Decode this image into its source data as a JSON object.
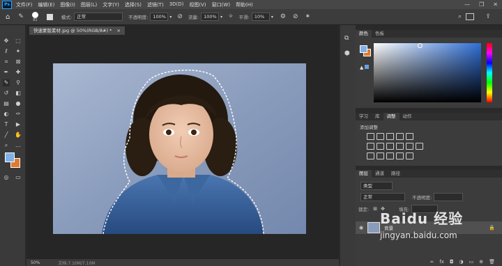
{
  "app": {
    "logo": "Ps"
  },
  "menu": [
    "文件(F)",
    "编辑(E)",
    "图像(I)",
    "图层(L)",
    "文字(Y)",
    "选择(S)",
    "滤镜(T)",
    "3D(D)",
    "视图(V)",
    "窗口(W)",
    "帮助(H)"
  ],
  "window_buttons": [
    "—",
    "❐",
    "✕"
  ],
  "options": {
    "brush_size": "81",
    "mode_label": "模式:",
    "mode_value": "正常",
    "opacity_label": "不透明度:",
    "opacity_value": "100%",
    "flow_label": "流量:",
    "flow_value": "100%",
    "smooth_label": "平滑:",
    "smooth_value": "10%"
  },
  "document": {
    "tab_title": "快速蒙版素材.jpg @ 50%(RGB/8#) *",
    "tab_close": "×",
    "zoom": "50%",
    "doc_info": "文档:7.10M/7.10M"
  },
  "color_panel": {
    "tabs": [
      "颜色",
      "色板"
    ],
    "accent": "#2f6fd6"
  },
  "adjust_panel": {
    "tabs": [
      "学习",
      "库",
      "调整",
      "动作"
    ],
    "subtitle": "添加调整"
  },
  "layers_panel": {
    "tabs": [
      "图层",
      "通道",
      "路径"
    ],
    "kind_label": "类型",
    "blend": "正常",
    "opacity_label": "不透明度:",
    "lock_label": "锁定:",
    "fill_label": "填充:",
    "layer_name": "背景"
  },
  "watermark": {
    "text": "Baidu 经验",
    "url": "jingyan.baidu.com"
  },
  "colors": {
    "fg": "#7fb0e8",
    "bg": "#e07a2f"
  }
}
